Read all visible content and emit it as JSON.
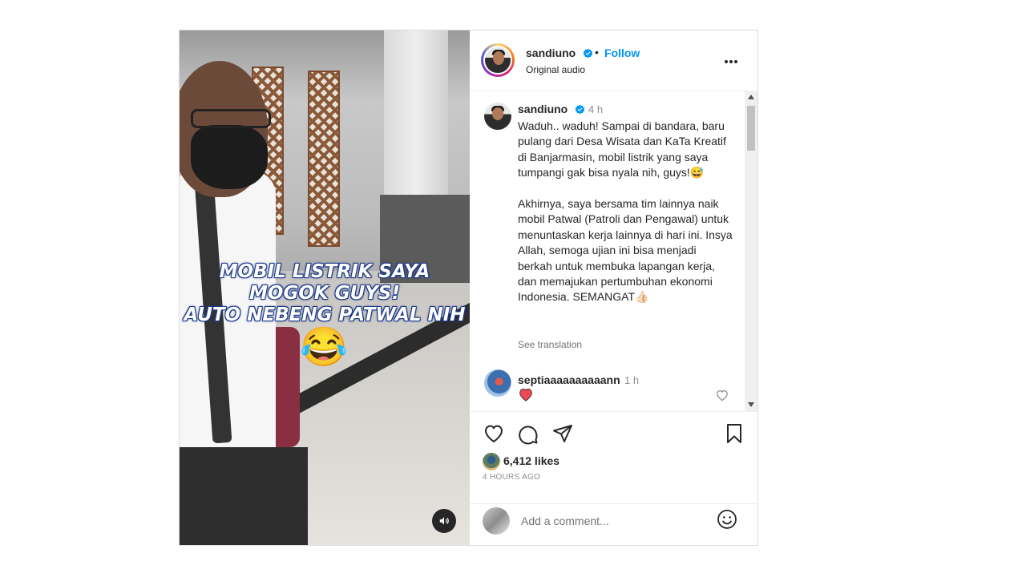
{
  "post": {
    "media": {
      "overlay_text": "MOBIL LISTRIK SAYA\nMOGOK GUYS!\nAUTO NEBENG PATWAL NIH",
      "overlay_emoji": "😂",
      "audio_icon": "speaker-icon"
    },
    "header": {
      "username": "sandiuno",
      "dot": "•",
      "follow_label": "Follow",
      "subtitle": "Original audio",
      "verified_icon": "verified-badge-icon",
      "more_icon": "more-options-icon"
    },
    "caption": {
      "username": "sandiuno",
      "time": "4 h",
      "text": "Waduh.. waduh! Sampai di bandara, baru pulang dari Desa Wisata dan KaTa Kreatif di Banjarmasin, mobil listrik yang saya tumpangi gak bisa nyala nih, guys!😅\n\nAkhirnya, saya bersama tim lainnya naik mobil Patwal (Patroli dan Pengawal) untuk menuntaskan kerja lainnya di hari ini. Insya Allah, semoga ujian ini bisa menjadi berkah untuk membuka lapangan kerja, dan memajukan pertumbuhan ekonomi Indonesia. SEMANGAT👍🏻",
      "see_translation": "See translation"
    },
    "comment": {
      "username": "septiaaaaaaaaaann",
      "time": "1 h",
      "emoji_icon": "red-heart-icon"
    },
    "actions": {
      "like_icon": "heart-icon",
      "comment_icon": "comment-icon",
      "share_icon": "share-icon",
      "save_icon": "bookmark-icon"
    },
    "likes": "6,412 likes",
    "time_ago": "4 HOURS AGO",
    "add_comment": {
      "placeholder": "Add a comment...",
      "emoji_icon": "smiley-icon"
    },
    "colors": {
      "link_blue": "#0095f6",
      "border": "#dbdbdb",
      "muted": "#8e8e8e",
      "heart_red": "#ed4956"
    }
  }
}
